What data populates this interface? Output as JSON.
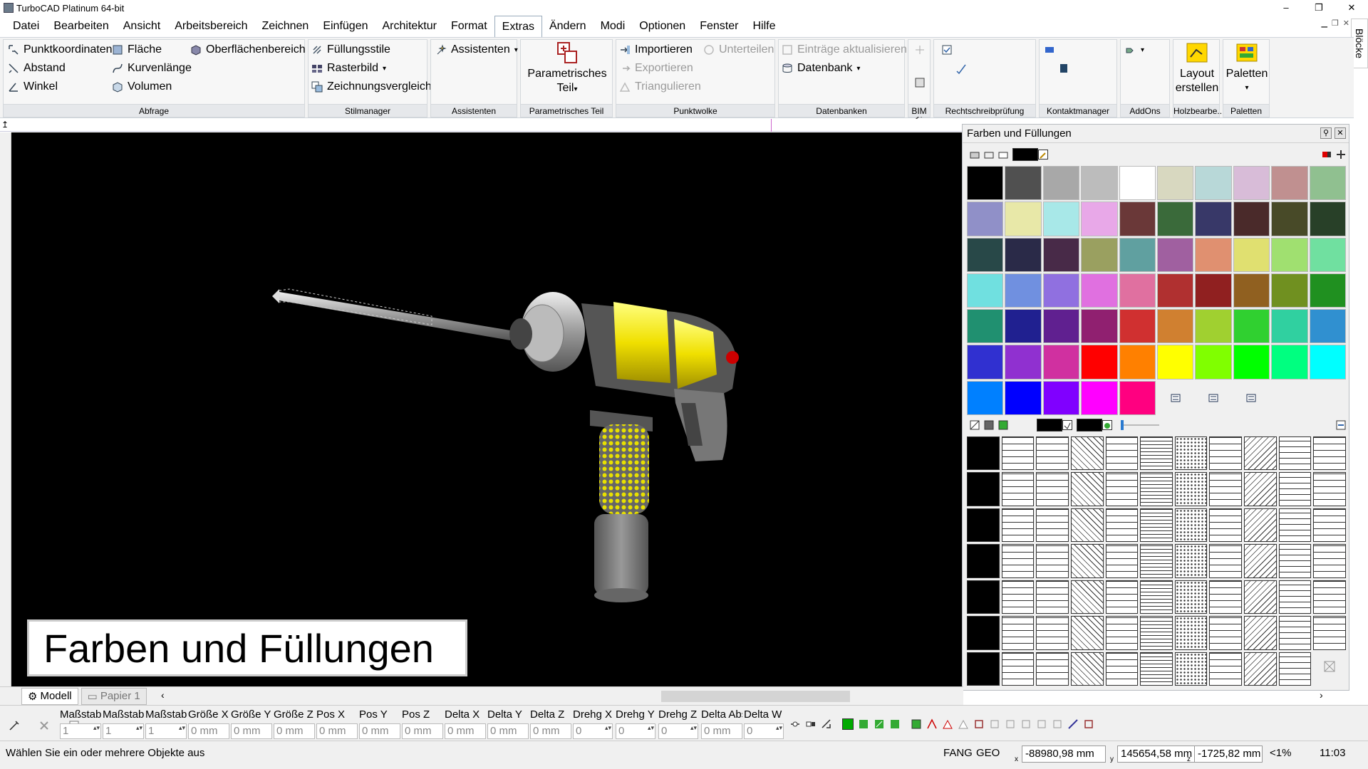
{
  "window": {
    "title": "TurboCAD  Platinum 64-bit",
    "controls": [
      "–",
      "❐",
      "✕"
    ]
  },
  "menu": [
    "Datei",
    "Bearbeiten",
    "Ansicht",
    "Arbeitsbereich",
    "Zeichnen",
    "Einfügen",
    "Architektur",
    "Format",
    "Extras",
    "Ändern",
    "Modi",
    "Optionen",
    "Fenster",
    "Hilfe"
  ],
  "menu_active": "Extras",
  "side_tab": "Blöcke",
  "ribbon": {
    "abfrage": {
      "label": "Abfrage",
      "items": [
        "Punktkoordinaten",
        "Abstand",
        "Winkel",
        "Fläche",
        "Kurvenlänge",
        "Volumen",
        "Oberflächenbereich"
      ]
    },
    "stilmanager": {
      "label": "Stilmanager",
      "items": [
        "Füllungsstile",
        "Rasterbild",
        "Zeichnungsvergleich"
      ]
    },
    "assistenten": {
      "label": "Assistenten",
      "items": [
        "Assistenten"
      ]
    },
    "parametrisch": {
      "label": "Parametrisches Teil",
      "line1": "Parametrisches",
      "line2": "Teil"
    },
    "punktwolke": {
      "label": "Punktwolke",
      "items": [
        "Importieren",
        "Exportieren",
        "Triangulieren",
        "Unterteilen"
      ]
    },
    "datenbanken": {
      "label": "Datenbanken",
      "items": [
        "Einträge aktualisieren",
        "Datenbank"
      ]
    },
    "bim": {
      "label": "BIM"
    },
    "rechtschreib": {
      "label": "Rechtschreibprüfung"
    },
    "kontakt": {
      "label": "Kontaktmanager"
    },
    "addons": {
      "label": "AddOns"
    },
    "holz": {
      "label": "Holzbearbe...",
      "line1": "Layout",
      "line2": "erstellen"
    },
    "paletten": {
      "label": "Paletten",
      "line1": "Paletten"
    }
  },
  "caption": "Farben und Füllungen",
  "palette": {
    "title": "Farben und Füllungen",
    "colors": [
      "#000000",
      "#505050",
      "#a8a8a8",
      "#bcbcbc",
      "#ffffff",
      "#d8d8c0",
      "#b8d8d8",
      "#d8bcd8",
      "#c09090",
      "#90c090",
      "#9090c8",
      "#e8e8a8",
      "#a8e8e8",
      "#e8a8e8",
      "#6a3838",
      "#3a6a3a",
      "#383868",
      "#4a2a2a",
      "#484a28",
      "#284028",
      "#284848",
      "#2a2a48",
      "#482a48",
      "#9aa060",
      "#60a0a0",
      "#a060a0",
      "#e09070",
      "#e0e070",
      "#a0e070",
      "#70e0a0",
      "#70e0e0",
      "#7090e0",
      "#9070e0",
      "#e070e0",
      "#e070a0",
      "#b03030",
      "#902020",
      "#906020",
      "#709020",
      "#209020",
      "#209070",
      "#202090",
      "#602090",
      "#902070",
      "#d03030",
      "#d08030",
      "#a0d030",
      "#30d030",
      "#30d0a0",
      "#3090d0",
      "#3030d0",
      "#9030d0",
      "#d030a0",
      "#ff0000",
      "#ff8000",
      "#ffff00",
      "#80ff00",
      "#00ff00",
      "#00ff80",
      "#00ffff",
      "#0080ff",
      "#0000ff",
      "#8000ff",
      "#ff00ff",
      "#ff0080"
    ]
  },
  "tabs": {
    "model": "Modell",
    "paper": "Papier 1"
  },
  "inspector": [
    {
      "label": "Maßstab X",
      "value": "1"
    },
    {
      "label": "Maßstab Y",
      "value": "1"
    },
    {
      "label": "Maßstab Z",
      "value": "1"
    },
    {
      "label": "Größe X",
      "value": "0 mm"
    },
    {
      "label": "Größe Y",
      "value": "0 mm"
    },
    {
      "label": "Größe Z",
      "value": "0 mm"
    },
    {
      "label": "Pos X",
      "value": "0 mm"
    },
    {
      "label": "Pos Y",
      "value": "0 mm"
    },
    {
      "label": "Pos Z",
      "value": "0 mm"
    },
    {
      "label": "Delta X",
      "value": "0 mm"
    },
    {
      "label": "Delta Y",
      "value": "0 mm"
    },
    {
      "label": "Delta Z",
      "value": "0 mm"
    },
    {
      "label": "Drehg X",
      "value": "0"
    },
    {
      "label": "Drehg Y",
      "value": "0"
    },
    {
      "label": "Drehg Z",
      "value": "0"
    },
    {
      "label": "Delta Abst",
      "value": "0 mm"
    },
    {
      "label": "Delta W",
      "value": "0"
    }
  ],
  "status": {
    "message": "Wählen Sie ein oder mehrere Objekte aus",
    "fang": "FANG",
    "geo": "GEO",
    "x": "-88980,98 mm",
    "y": "145654,58 mm",
    "z": "-1725,82 mm",
    "zoom": "<1%",
    "time": "11:03"
  }
}
